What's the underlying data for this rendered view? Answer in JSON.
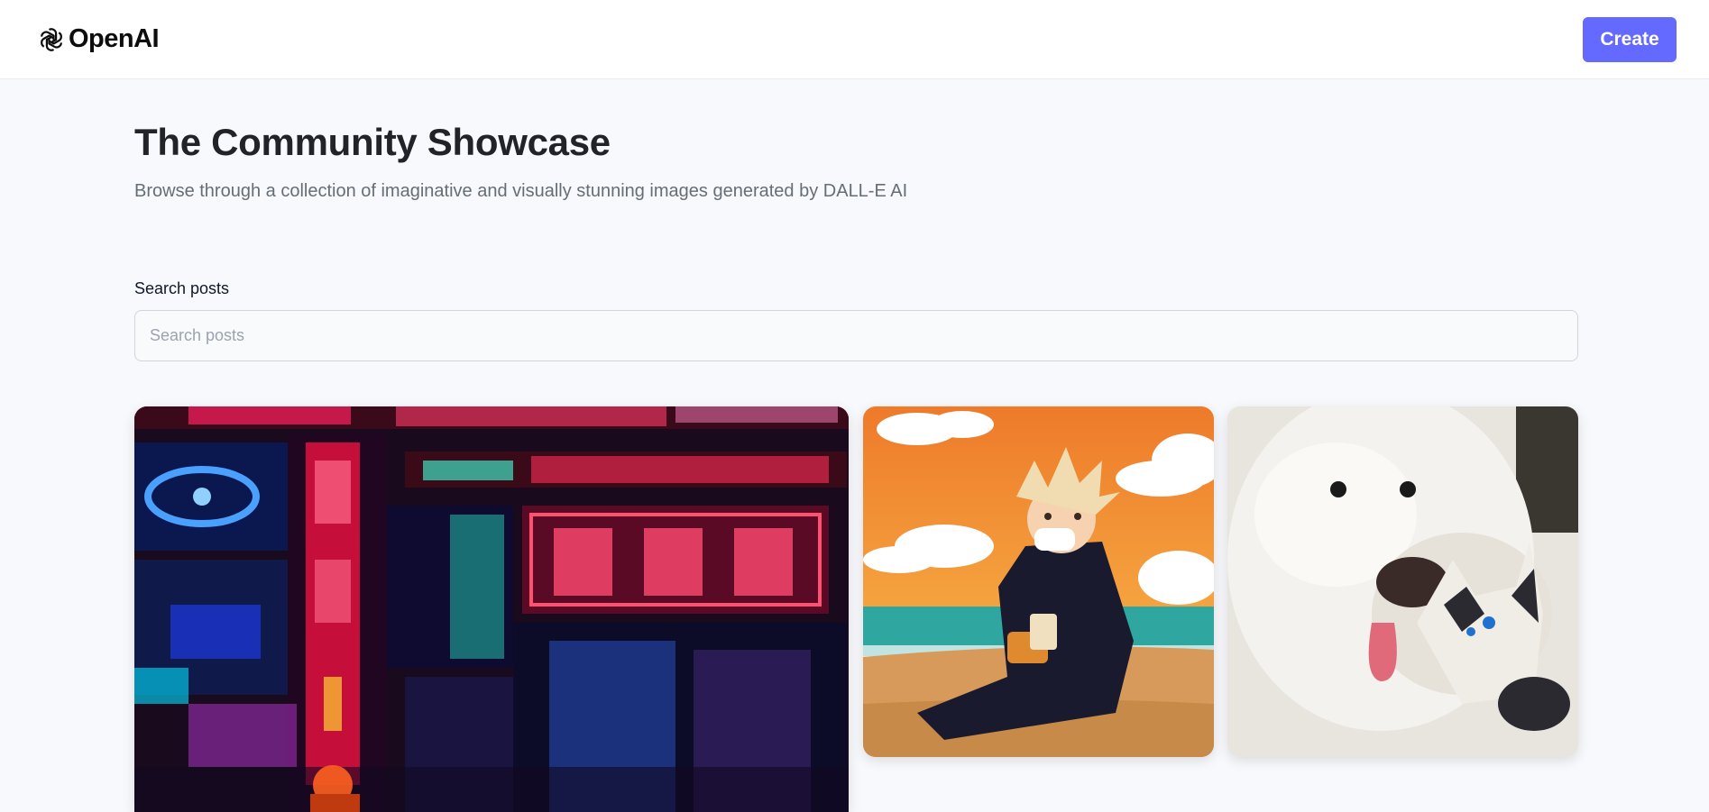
{
  "header": {
    "brand": "OpenAI",
    "create_label": "Create"
  },
  "hero": {
    "title": "The Community Showcase",
    "subtitle": "Browse through a collection of imaginative and visually stunning images generated by DALL-E AI"
  },
  "search": {
    "label": "Search posts",
    "placeholder": "Search posts",
    "value": ""
  },
  "posts": [
    {
      "subject": "neon-city-night"
    },
    {
      "subject": "anime-character-beach"
    },
    {
      "subject": "white-dog-and-cat"
    }
  ],
  "colors": {
    "accent": "#6469ff",
    "title": "#222328",
    "subtitle": "#666e75",
    "background": "#f8f9fc"
  }
}
